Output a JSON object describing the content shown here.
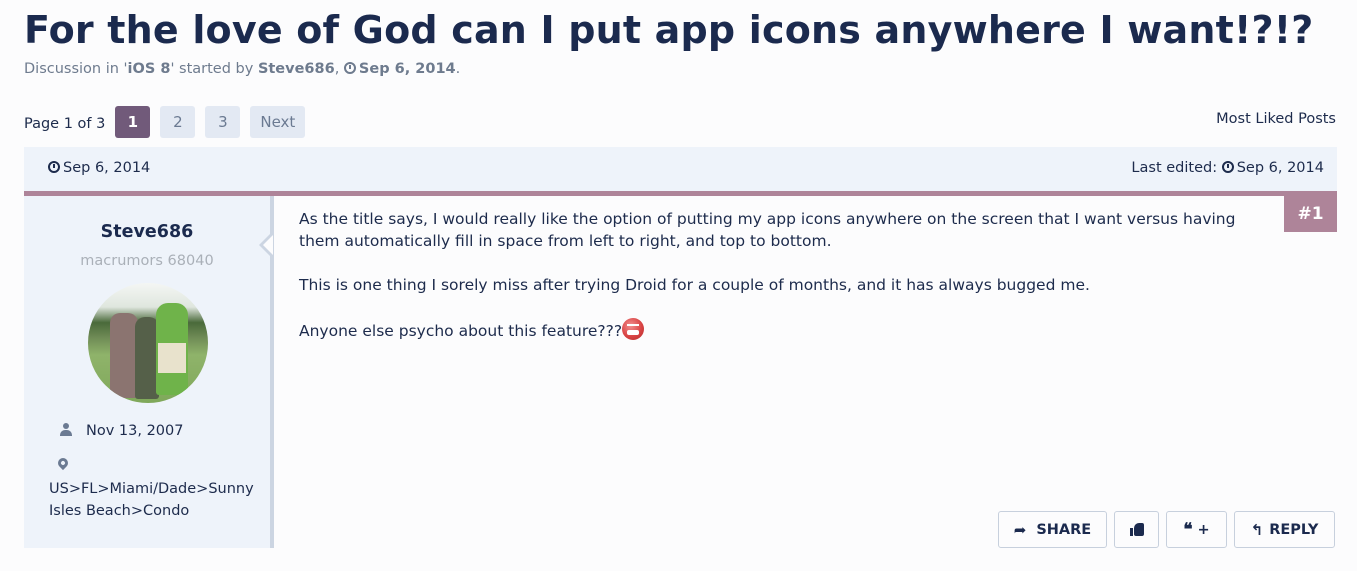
{
  "thread": {
    "title": "For the love of God can I put app icons anywhere I want!?!?",
    "subtitle_prefix": "Discussion in '",
    "forum": "iOS 8",
    "subtitle_mid": "' started by ",
    "author": "Steve686",
    "subtitle_sep": ", ",
    "date": "Sep 6, 2014",
    "subtitle_end": "."
  },
  "pagination": {
    "label": "Page 1 of 3",
    "pages": [
      "1",
      "2",
      "3"
    ],
    "current_page": "1",
    "next_label": "Next"
  },
  "most_liked_label": "Most Liked Posts",
  "post": {
    "date": "Sep 6, 2014",
    "last_edited_label": "Last edited:",
    "last_edited_date": "Sep 6, 2014",
    "number": "#1",
    "paragraphs": [
      "As the title says, I would really like the option of putting my app icons anywhere on the screen that I want versus having them automatically fill in space from left to right, and top to bottom.",
      "This is one thing I sorely miss after trying Droid for a couple of months, and it has always bugged me.",
      "Anyone else psycho about this feature???"
    ],
    "emoji": "mad-smiley"
  },
  "user": {
    "name": "Steve686",
    "title": "macrumors 68040",
    "joined": "Nov 13, 2007",
    "location": "US>FL>Miami/Dade>Sunny Isles Beach>Condo"
  },
  "actions": {
    "share_label": "SHARE",
    "quote_label": "+",
    "reply_label": "REPLY"
  },
  "colors": {
    "accent": "#ae8499",
    "active_page": "#715a7a",
    "title": "#1b2a4e",
    "panel_bg": "#eef3fa"
  }
}
